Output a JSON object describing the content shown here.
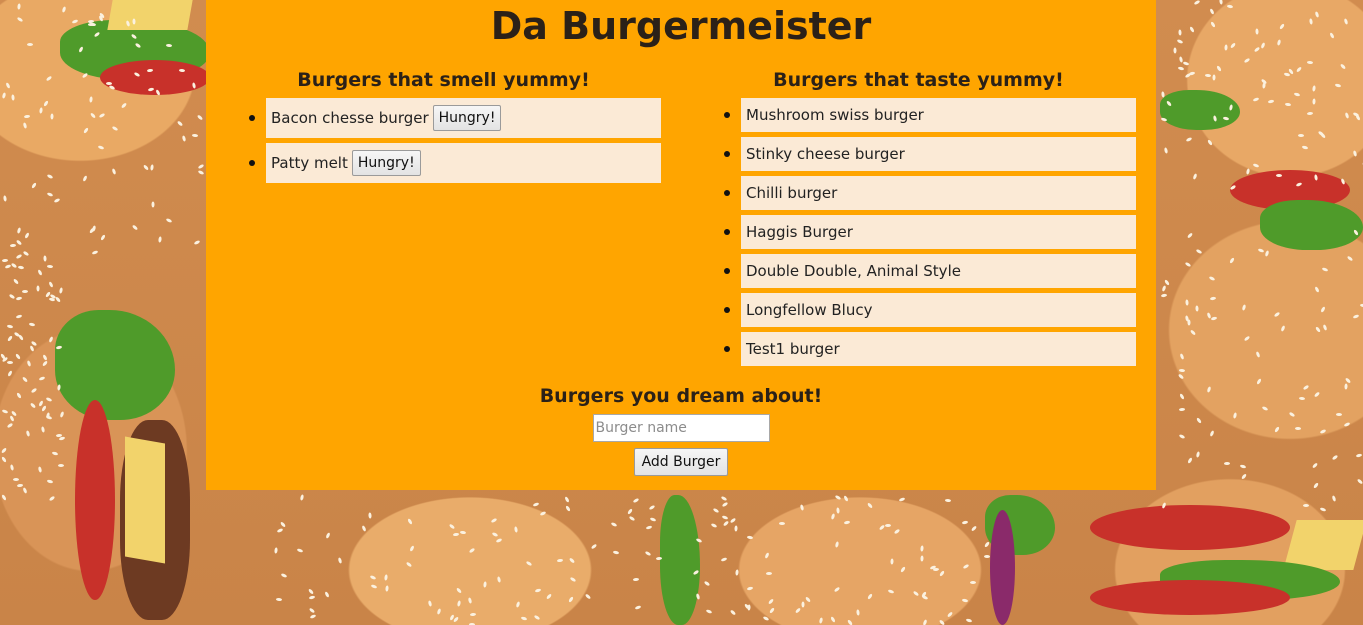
{
  "page": {
    "title": "Da Burgermeister"
  },
  "smell": {
    "heading": "Burgers that smell yummy!",
    "items": [
      {
        "name": "Bacon chesse burger",
        "button": "Hungry!"
      },
      {
        "name": "Patty melt",
        "button": "Hungry!"
      }
    ]
  },
  "taste": {
    "heading": "Burgers that taste yummy!",
    "items": [
      {
        "name": "Mushroom swiss burger"
      },
      {
        "name": "Stinky cheese burger"
      },
      {
        "name": "Chilli burger"
      },
      {
        "name": "Haggis Burger"
      },
      {
        "name": "Double Double, Animal Style"
      },
      {
        "name": "Longfellow Blucy"
      },
      {
        "name": "Test1 burger"
      }
    ]
  },
  "dream": {
    "heading": "Burgers you dream about!",
    "input_placeholder": "Burger name",
    "input_value": "",
    "submit_label": "Add Burger"
  },
  "colors": {
    "panel": "#ffa500",
    "list_item": "#fbead6",
    "text": "#2b2118"
  }
}
